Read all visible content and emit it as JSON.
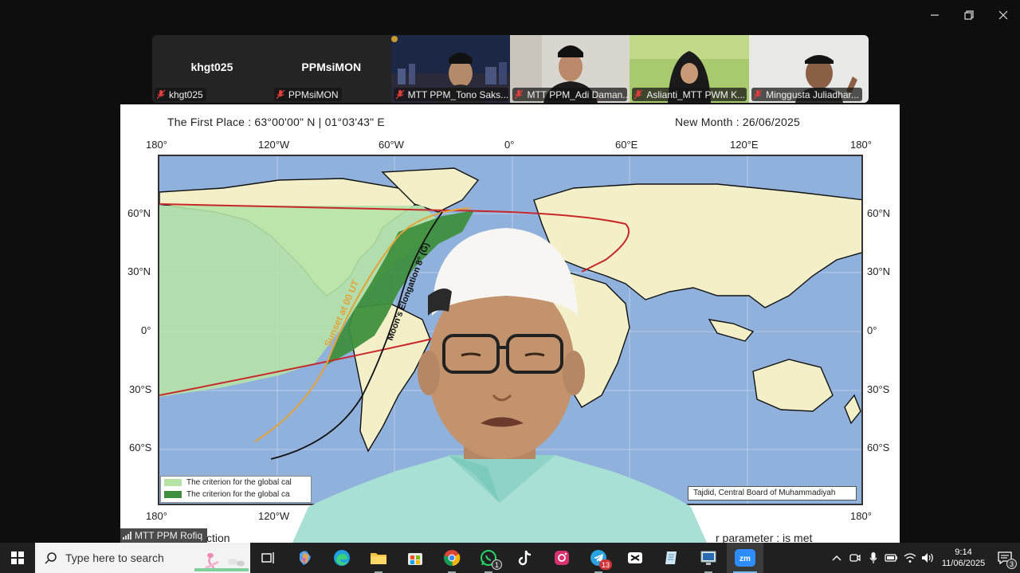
{
  "window": {
    "minimize_icon": "minimize-icon",
    "restore_icon": "restore-icon",
    "close_icon": "close-icon"
  },
  "participants": [
    {
      "display_name": "khgt025",
      "label": "khgt025",
      "has_video": false
    },
    {
      "display_name": "PPMsiMON",
      "label": "PPMsiMON",
      "has_video": false
    },
    {
      "label": "MTT PPM_Tono Saks...",
      "has_video": true
    },
    {
      "label": "MTT PPM_Adi Daman...",
      "has_video": true
    },
    {
      "label": "Aslianti_MTT PWM K...",
      "has_video": true
    },
    {
      "label": "Minggusta Juliadhar...",
      "has_video": true
    }
  ],
  "shared_screen": {
    "first_place": "The First Place    : 63°00'00\" N | 01°03'43\" E",
    "new_month": "New Month    : 26/06/2025",
    "lon_ticks": [
      "180°",
      "120°W",
      "60°W",
      "0°",
      "60°E",
      "120°E",
      "180°"
    ],
    "lat_ticks": [
      "60°N",
      "30°N",
      "0°",
      "30°S",
      "60°S"
    ],
    "curve_labels": {
      "sunset": "Sunset at 00 UT",
      "elongation": "Moon's Elongation 8° (G)"
    },
    "legend": [
      {
        "text": "The criterion for the global cal",
        "color": "#b5e3a6"
      },
      {
        "text": "The criterion for the global ca",
        "color": "#3f8f3d"
      }
    ],
    "credit": "Tajdid, Central Board of Muhammadiyah",
    "bottom_left": "ction",
    "bottom_right": "r parameter       : is met",
    "colors": {
      "ocean": "#8fb1dc",
      "land": "#f3efc8",
      "light_region": "#b5e3a6",
      "dark_region": "#3f8f3d",
      "red_line": "#c8282a",
      "orange_line": "#e4a33a"
    }
  },
  "active_speaker": {
    "label": "MTT PPM Rofiq"
  },
  "taskbar": {
    "search_placeholder": "Type here to search",
    "apps": [
      {
        "name": "task-view-icon"
      },
      {
        "name": "copilot-icon"
      },
      {
        "name": "edge-icon"
      },
      {
        "name": "file-explorer-icon"
      },
      {
        "name": "microsoft-store-icon"
      },
      {
        "name": "chrome-icon"
      },
      {
        "name": "whatsapp-icon",
        "badge": "1"
      },
      {
        "name": "tiktok-icon"
      },
      {
        "name": "instagram-icon"
      },
      {
        "name": "telegram-icon",
        "badge": "13"
      },
      {
        "name": "capcut-icon"
      },
      {
        "name": "notepad-icon"
      },
      {
        "name": "remote-desktop-icon"
      },
      {
        "name": "zoom-icon"
      }
    ],
    "time": "9:14",
    "date": "11/06/2025",
    "notifications": "3"
  }
}
